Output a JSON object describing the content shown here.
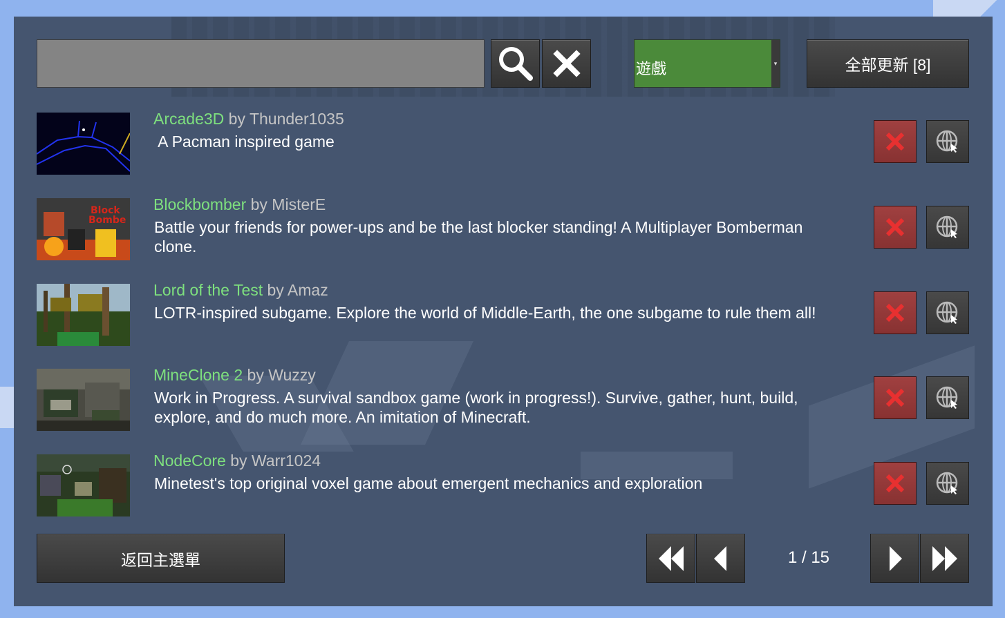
{
  "search": {
    "value": "",
    "icon": "search-icon",
    "clear_icon": "close-icon"
  },
  "filter": {
    "selected": "遊戲",
    "color": "#4b8a3a"
  },
  "update_all_label": "全部更新 [8]",
  "packages": [
    {
      "title": "Arcade3D",
      "by": "by Thunder1035",
      "description": " A Pacman inspired game"
    },
    {
      "title": "Blockbomber",
      "by": "by MisterE",
      "description": "Battle your friends for power-ups and be the last blocker standing! A Multiplayer Bomberman clone."
    },
    {
      "title": "Lord of the Test",
      "by": "by Amaz",
      "description": "LOTR-inspired subgame. Explore the world of Middle-Earth, the one subgame to rule them all!"
    },
    {
      "title": "MineClone 2",
      "by": "by Wuzzy",
      "description": "Work in Progress. A survival sandbox game (work in progress!). Survive, gather, hunt, build, explore, and do much more. An imitation of Minecraft."
    },
    {
      "title": "NodeCore",
      "by": "by Warr1024",
      "description": "Minetest's top original voxel game about emergent mechanics and exploration"
    }
  ],
  "back_label": "返回主選單",
  "pagination": {
    "text": "1 / 15"
  },
  "colors": {
    "title_green": "#7ee07e",
    "delete_red": "#a04040",
    "panel": "#45556f"
  }
}
